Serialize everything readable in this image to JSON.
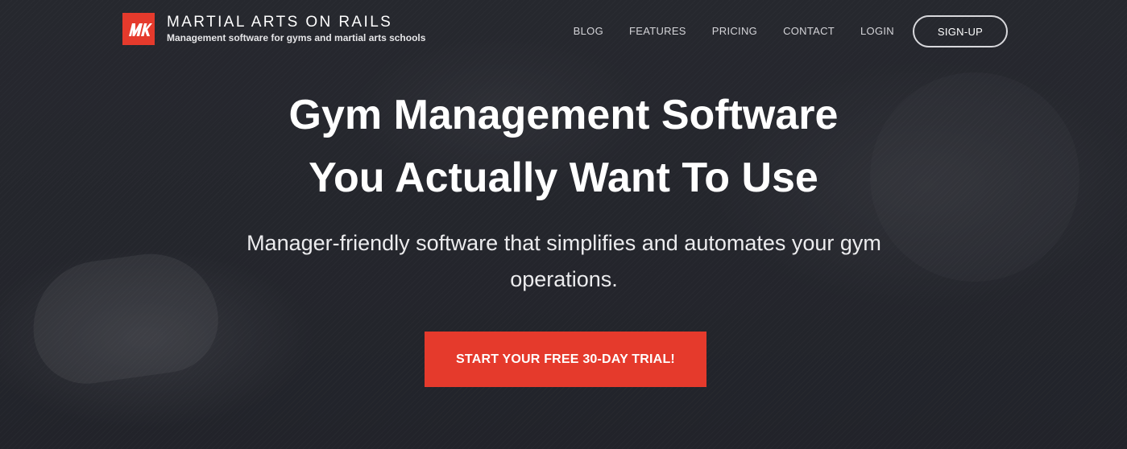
{
  "brand": {
    "name": "MARTIAL ARTS ON RAILS",
    "tagline": "Management software for gyms and martial arts schools",
    "accent_color": "#e53a2c",
    "logo_icon": "mr-monogram-icon"
  },
  "nav": {
    "items": [
      {
        "label": "BLOG"
      },
      {
        "label": "FEATURES"
      },
      {
        "label": "PRICING"
      },
      {
        "label": "CONTACT"
      },
      {
        "label": "LOGIN"
      }
    ],
    "signup_label": "SIGN-UP"
  },
  "hero": {
    "headline_line1": "Gym Management Software",
    "headline_line2": "You Actually Want To Use",
    "subtitle": "Manager-friendly software that simplifies and automates your gym operations.",
    "cta_label": "START YOUR FREE 30-DAY TRIAL!",
    "background_color": "#2b2c33"
  }
}
